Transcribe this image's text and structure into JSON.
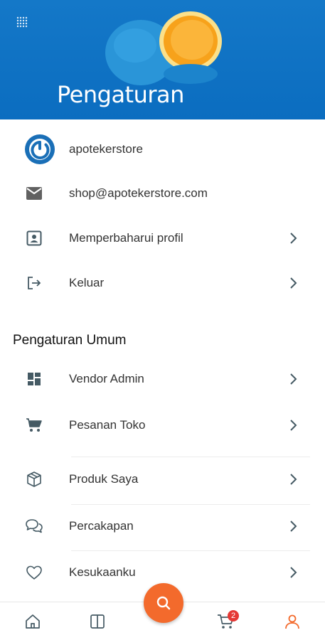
{
  "header": {
    "title": "Pengaturan"
  },
  "account": {
    "store_name": "apotekerstore",
    "email": "shop@apotekerstore.com",
    "update_profile_label": "Memperbaharui profil",
    "logout_label": "Keluar"
  },
  "general": {
    "section_title": "Pengaturan Umum",
    "items": [
      {
        "label": "Vendor Admin",
        "icon": "dashboard-icon"
      },
      {
        "label": "Pesanan Toko",
        "icon": "cart-icon"
      },
      {
        "label": "Produk Saya",
        "icon": "box-icon"
      },
      {
        "label": "Percakapan",
        "icon": "chat-icon"
      },
      {
        "label": "Kesukaanku",
        "icon": "heart-icon"
      }
    ]
  },
  "bottom_nav": {
    "cart_badge": "2",
    "active_color": "#f36a2c"
  },
  "colors": {
    "header_blue": "#0b6dc0",
    "accent_orange": "#f36a2c",
    "icon_gray": "#455a64"
  }
}
